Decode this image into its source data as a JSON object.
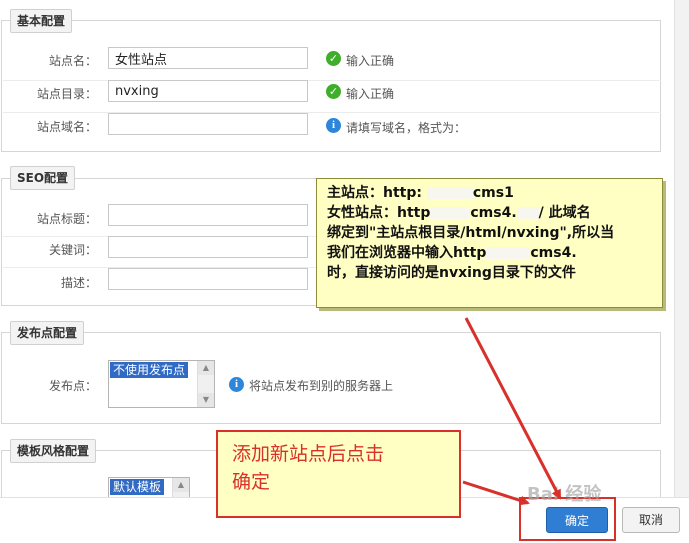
{
  "basic": {
    "legend": "基本配置",
    "site_name_label": "站点名：",
    "site_name_value": "女性站点",
    "site_name_status": "输入正确",
    "site_dir_label": "站点目录：",
    "site_dir_value": "nvxing",
    "site_dir_status": "输入正确",
    "site_domain_label": "站点域名：",
    "site_domain_hint": "请填写域名，格式为："
  },
  "seo": {
    "legend": "SEO配置",
    "title_label": "站点标题：",
    "keywords_label": "关键词：",
    "desc_label": "描述："
  },
  "publish": {
    "legend": "发布点配置",
    "label": "发布点：",
    "option_selected": "不使用发布点",
    "hint": "将站点发布到别的服务器上"
  },
  "template": {
    "legend": "模板风格配置",
    "option_selected": "默认模板"
  },
  "callout_main": {
    "line1": "主站点：http:",
    "line1b": "cms1",
    "line2": "女性站点：http",
    "line2b": "cms4.",
    "line2c": "/  此域名",
    "line3": "绑定到\"主站点根目录/html/nvxing\",所以当",
    "line4": "我们在浏览器中输入http",
    "line4b": "cms4.",
    "line5": "时，直接访问的是nvxing目录下的文件"
  },
  "callout_ok": {
    "line1": "添加新站点后点击",
    "line2": "确定"
  },
  "buttons": {
    "ok": "确定",
    "cancel": "取消"
  },
  "watermark": "Bai 经验",
  "colors": {
    "callout_bg": "#ffffc4",
    "accent_red": "#d8302a",
    "ok_green": "#3fae2a",
    "info_blue": "#2d86d9",
    "button_blue": "#2f7ed3"
  }
}
